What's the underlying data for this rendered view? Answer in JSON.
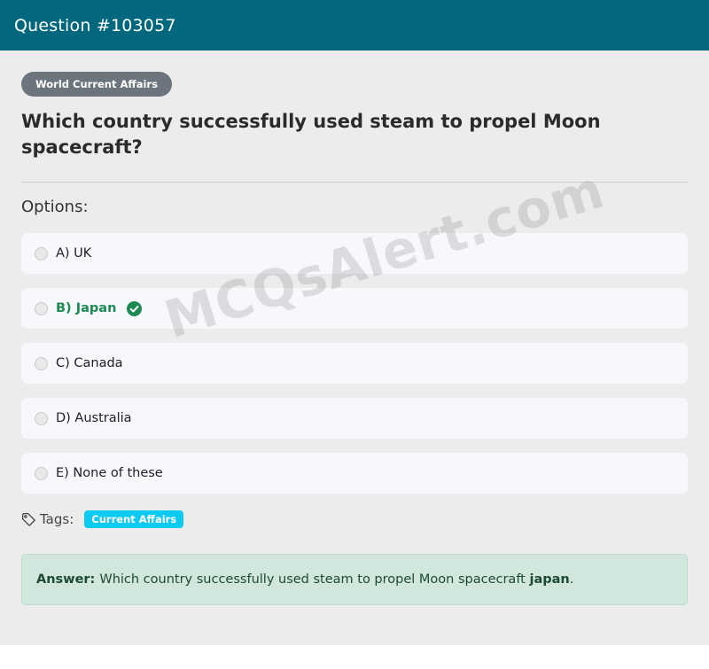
{
  "header": {
    "title": "Question #103057"
  },
  "category": {
    "label": "World Current Affairs"
  },
  "question": {
    "text": "Which country successfully used steam to propel Moon spacecraft?"
  },
  "options_heading": "Options:",
  "options": [
    {
      "label": "A) UK",
      "correct": false
    },
    {
      "label": "B) Japan",
      "correct": true
    },
    {
      "label": "C) Canada",
      "correct": false
    },
    {
      "label": "D) Australia",
      "correct": false
    },
    {
      "label": "E) None of these",
      "correct": false
    }
  ],
  "watermark": "MCQsAlert.com",
  "tags": {
    "label": "Tags:",
    "items": [
      "Current Affairs"
    ]
  },
  "answer": {
    "label": "Answer:",
    "text": "Which country successfully used steam to propel Moon spacecraft",
    "value": "japan",
    "suffix": "."
  },
  "colors": {
    "header_bg": "#03677e",
    "correct": "#1e8a53",
    "tag_badge": "#0dcaf0",
    "answer_bg": "#d1e7dd"
  },
  "icons": {
    "correct": "check-circle-icon",
    "tag": "tag-icon"
  }
}
